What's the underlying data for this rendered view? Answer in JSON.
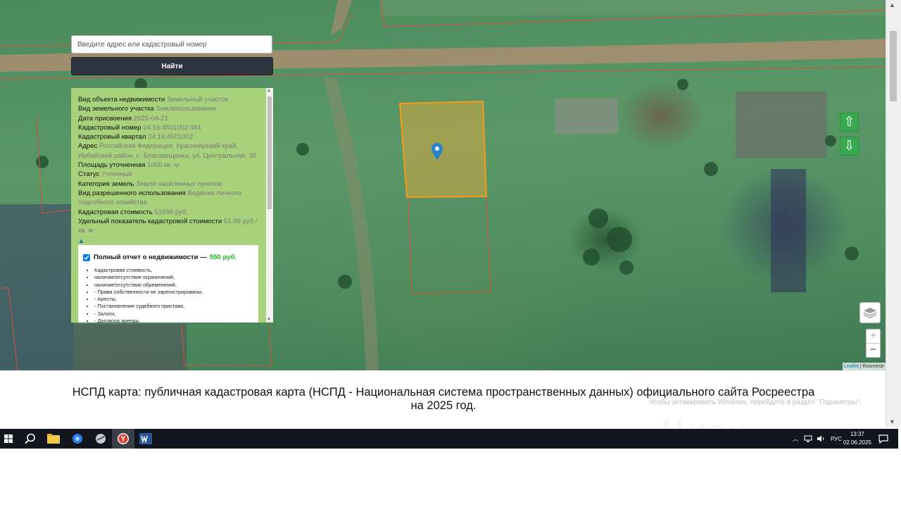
{
  "search": {
    "placeholder": "Введите адрес или кадастровый номер",
    "button_label": "Найти"
  },
  "info": {
    "rows": [
      {
        "key": "Вид объекта недвижимости",
        "value": "Земельный участок"
      },
      {
        "key": "Вид земельного участка",
        "value": "Землепользование"
      },
      {
        "key": "Дата присвоения",
        "value": "2025-04-21"
      },
      {
        "key": "Кадастровый номер",
        "value": "24:16:4501002:461"
      },
      {
        "key": "Кадастровый квартал",
        "value": "24:16:4501002"
      },
      {
        "key": "Адрес",
        "value": "Российская Федерация, Красноярский край, Ирбейский район, с. Благовещенка, ул. Центральная, 30"
      },
      {
        "key": "Площадь уточненная",
        "value": "1000 кв. м"
      },
      {
        "key": "Статус",
        "value": "Учтенный"
      },
      {
        "key": "Категория земель",
        "value": "Земли населенных пунктов"
      },
      {
        "key": "Вид разрешенного использования",
        "value": "Ведение личного подсобного хозяйства"
      },
      {
        "key": "Кадастровая стоимость",
        "value": "51890 руб."
      },
      {
        "key": "Удельный показатель кадастровой стоимости",
        "value": "51.89 руб / кв. м"
      }
    ],
    "collapse_glyph": "▲"
  },
  "report": {
    "checked": true,
    "title": "Полный отчет о недвижимости —",
    "price": "550 руб.",
    "items": [
      "Кадастровая стоимость,",
      "наличие/отсутствие ограничений,",
      "наличие/отсутствие обременений,",
      "- Права собственности не зарегистрированы,",
      "- Аресты,",
      "- Постановление судебного пристава,",
      "- Залоги,",
      "- Договора аренды"
    ]
  },
  "map_controls": {
    "up_glyph": "⇧",
    "down_glyph": "⇩",
    "zoom_in": "+",
    "zoom_out": "−",
    "attribution_leaflet": "Leaflet",
    "attribution_rest": " | Rosreestr"
  },
  "caption": {
    "text": "НСПД карта: публичная кадастровая карта (НСПД - Национальная система пространственных данных) официального сайта Росреестра на 2025 год."
  },
  "overlay": {
    "activate_hint": "Чтобы активировать Windows, перейдите в раздел \"Параметры\".",
    "watermark": "Циан"
  },
  "taskbar": {
    "language": "РУС",
    "time": "13:37",
    "date": "02.06.2025"
  },
  "colors": {
    "panel_bg": "#a7d17a",
    "selected_parcel": "#f59a1a",
    "parcel_border": "#d9503a",
    "nav_button": "#39a94f",
    "price": "#1fb51f",
    "search_button": "#2e3440"
  }
}
